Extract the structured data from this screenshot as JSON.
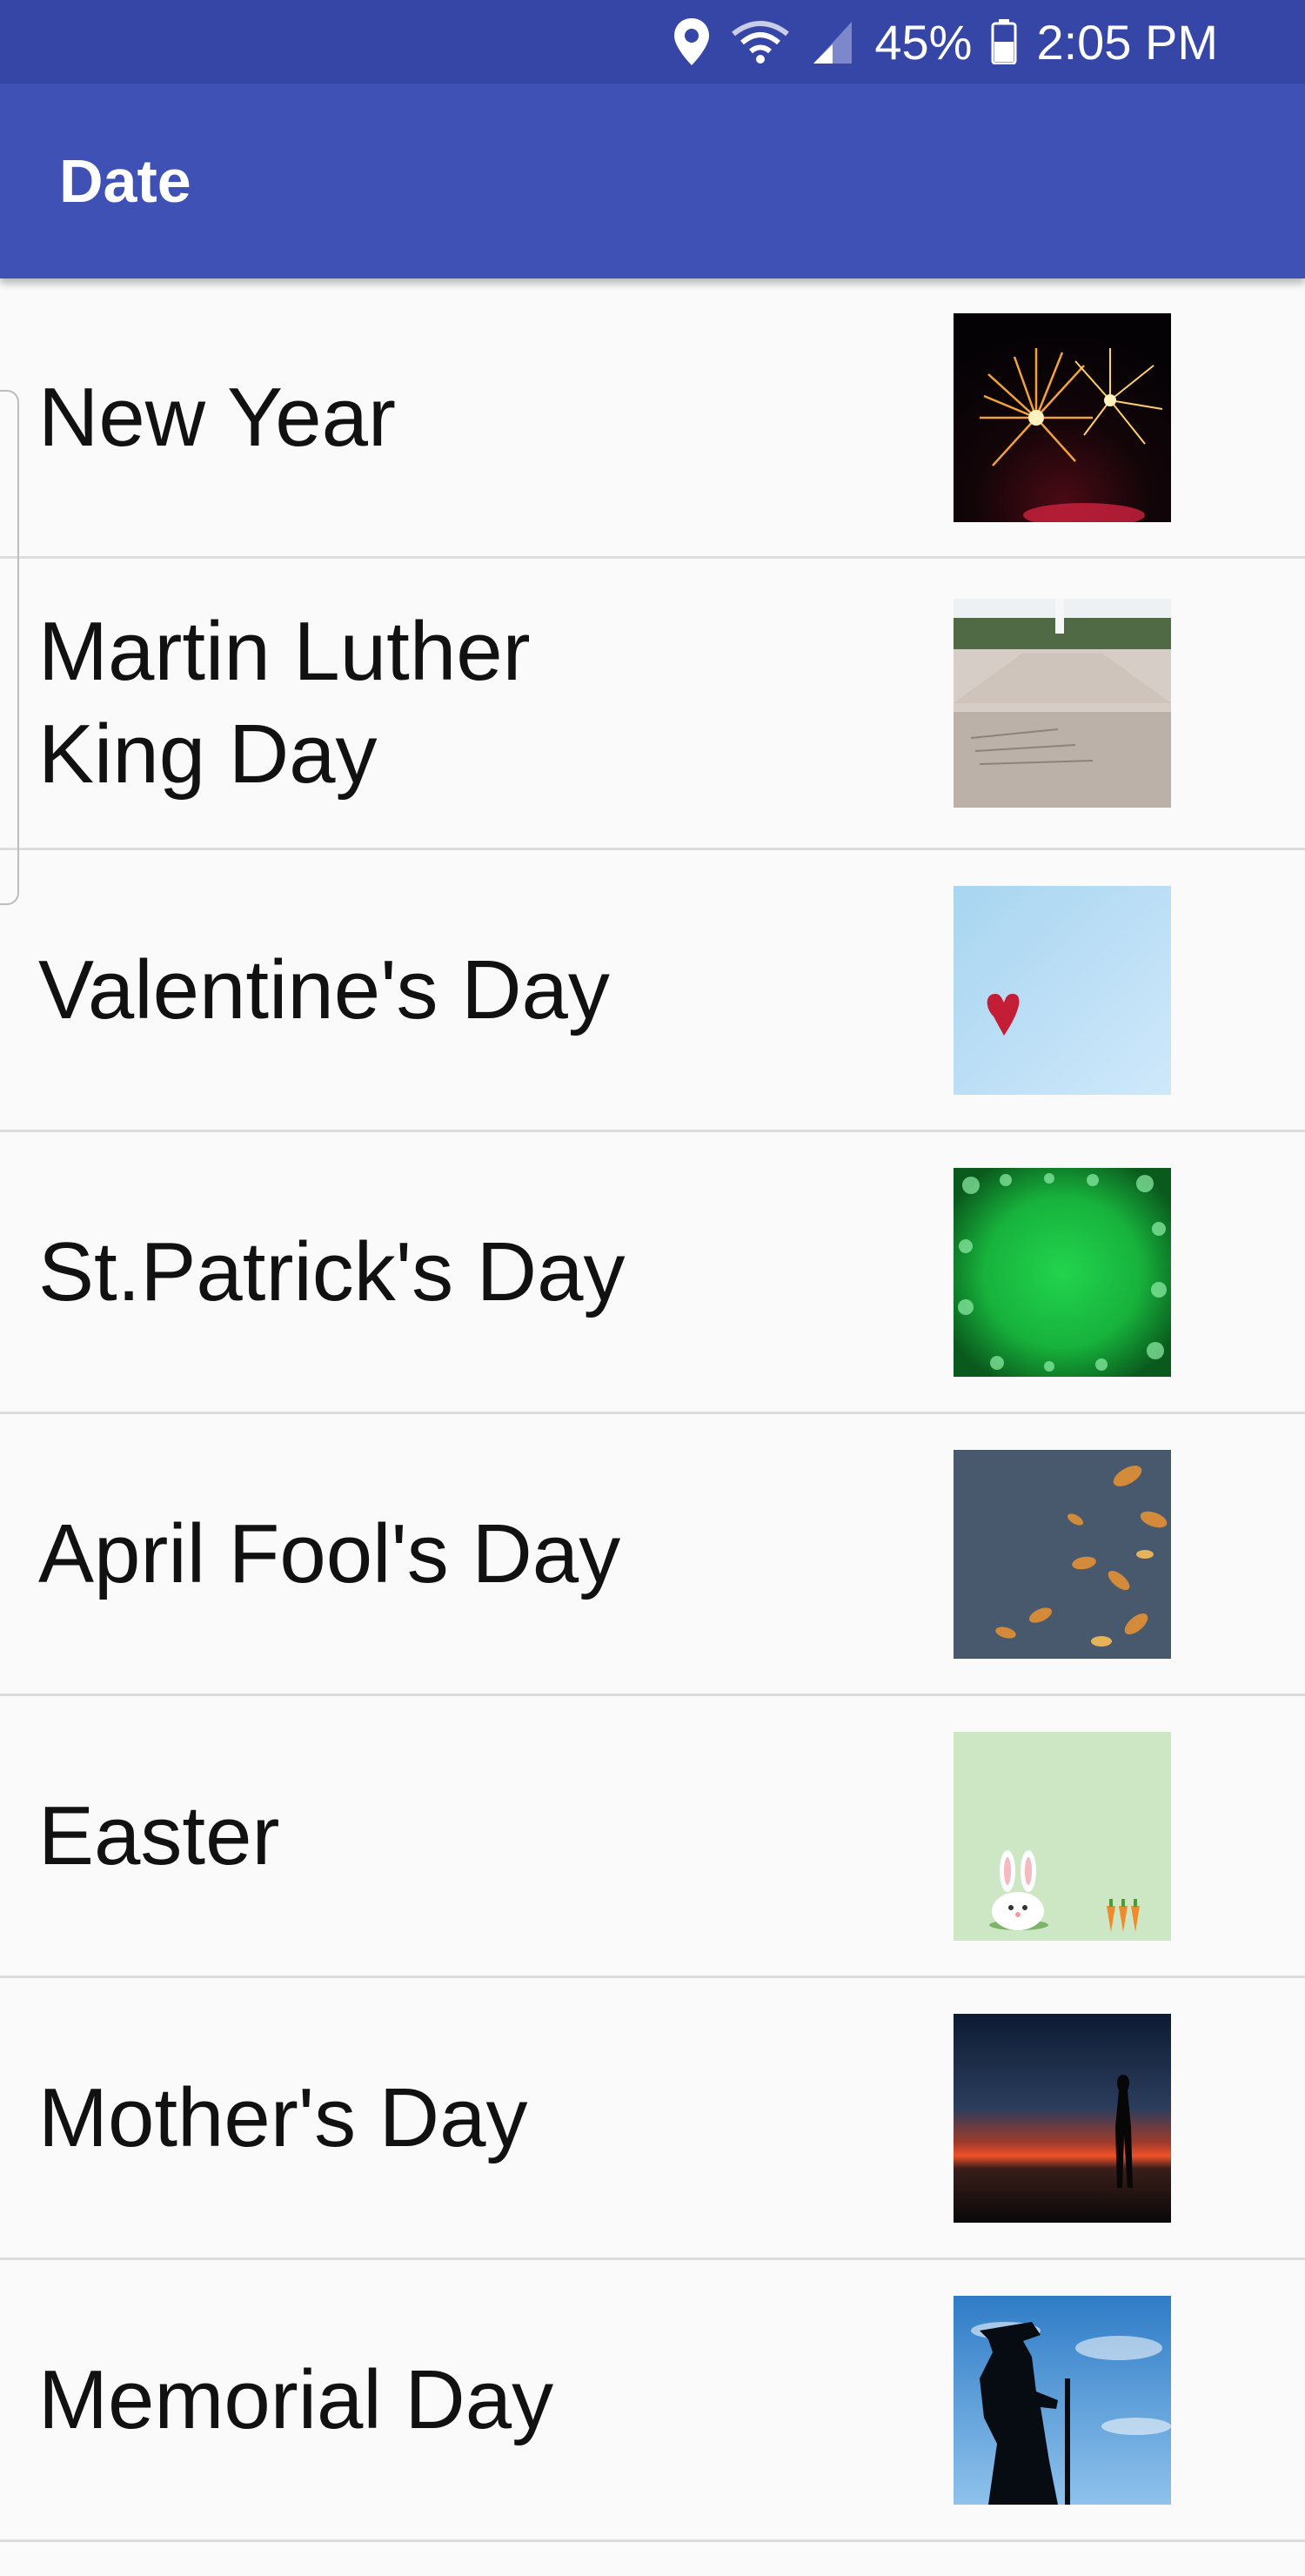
{
  "status_bar": {
    "battery": "45%",
    "time": "2:05 PM",
    "icons": [
      "location-icon",
      "wifi-icon",
      "signal-icon",
      "battery-icon"
    ]
  },
  "app_bar": {
    "title": "Date"
  },
  "colors": {
    "status_bar": "#3546a6",
    "app_bar": "#3f51b5",
    "background": "#fafafa",
    "divider": "#dcdcdc"
  },
  "list": {
    "items": [
      {
        "label": "New Year",
        "image": "fireworks-image"
      },
      {
        "label": "Martin Luther King Day",
        "image": "memorial-plaza-image"
      },
      {
        "label": "Valentine's Day",
        "image": "heart-on-snow-image"
      },
      {
        "label": "St.Patrick's Day",
        "image": "green-snowflake-frame-image"
      },
      {
        "label": "April Fool's Day",
        "image": "autumn-leaves-puddle-image"
      },
      {
        "label": "Easter",
        "image": "bunny-carrots-image"
      },
      {
        "label": "Mother's Day",
        "image": "sunset-silhouette-image"
      },
      {
        "label": "Memorial Day",
        "image": "soldier-silhouette-image"
      }
    ]
  }
}
